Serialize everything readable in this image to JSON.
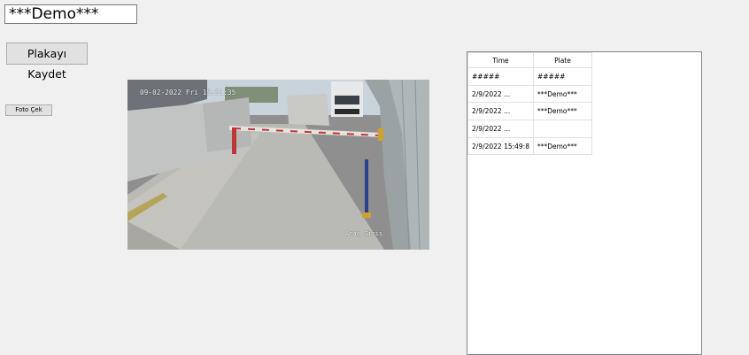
{
  "plate_input": {
    "value": "***Demo***"
  },
  "buttons": {
    "save_label": "Plakayı Kaydet",
    "photo_label": "Foto Çek"
  },
  "camera": {
    "timestamp": "09-02-2022 Fri 15:51:35",
    "label": "Araç Giriş"
  },
  "grid": {
    "columns": [
      "Time",
      "Plate"
    ],
    "rows": [
      {
        "time": "#####",
        "plate": "#####"
      },
      {
        "time": "2/9/2022  ...",
        "plate": "***Demo***"
      },
      {
        "time": "2/9/2022  ...",
        "plate": "***Demo***"
      },
      {
        "time": "2/9/2022  ...",
        "plate": ""
      },
      {
        "time": "2/9/2022  15:49:8",
        "plate": "***Demo***"
      }
    ]
  }
}
